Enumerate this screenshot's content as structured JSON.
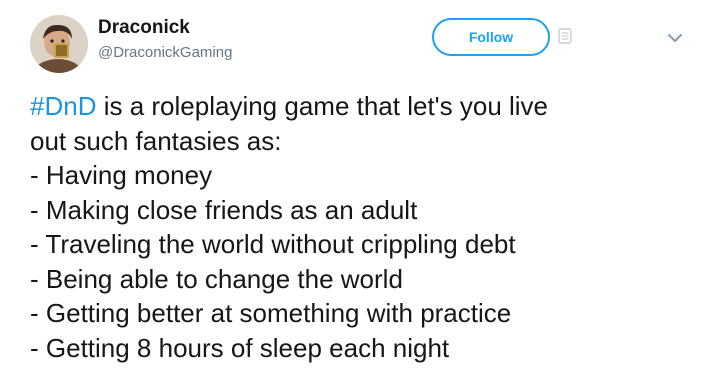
{
  "user": {
    "display_name": "Draconick",
    "handle": "@DraconickGaming"
  },
  "follow_button": {
    "label": "Follow"
  },
  "icons": {
    "more": "more-options-icon",
    "caret": "chevron-down-icon"
  },
  "tweet": {
    "hashtag": "#DnD",
    "intro_rest": " is a roleplaying game that let's you live",
    "intro_line2": "out such fantasies as:",
    "items": [
      "- Having money",
      "- Making close friends as an adult",
      "- Traveling the world without crippling debt",
      "- Being able to change the world",
      "- Getting better at something with practice",
      "- Getting 8 hours of sleep each night"
    ]
  },
  "colors": {
    "text": "#14171a",
    "secondary": "#657786",
    "accent": "#1da1f2",
    "hashtag": "#1b95e0"
  }
}
